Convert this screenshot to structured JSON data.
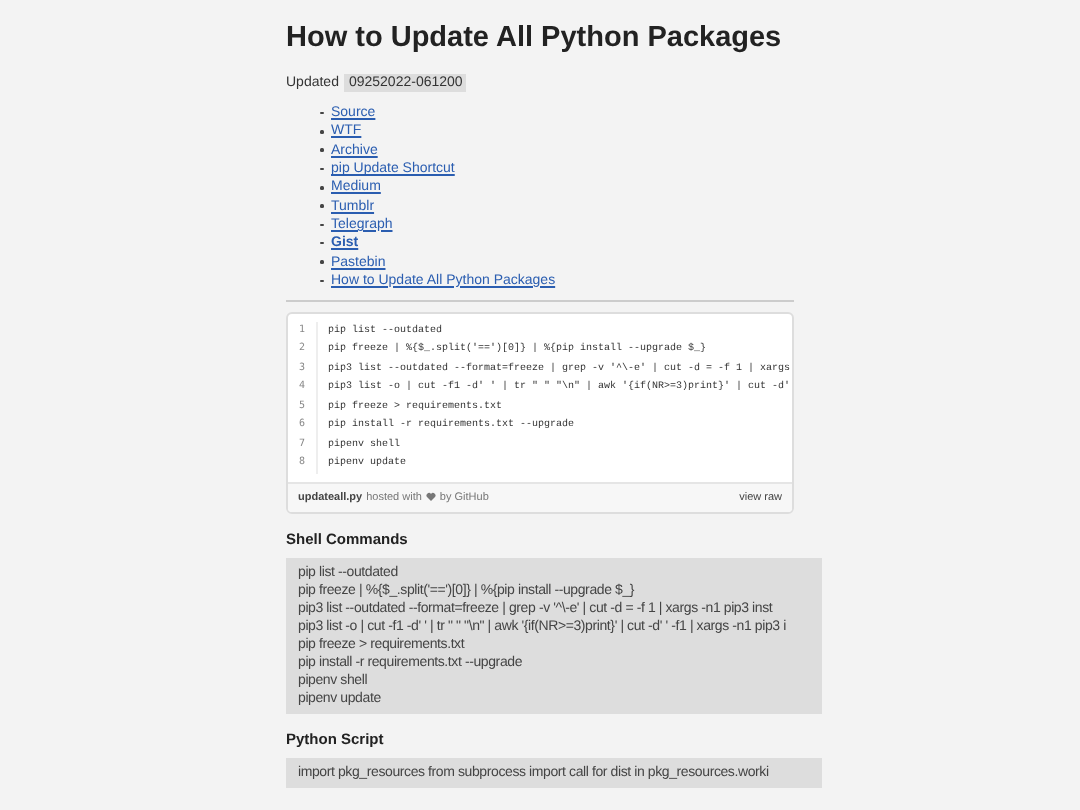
{
  "title": "How to Update All Python Packages",
  "updated": {
    "label": "Updated",
    "stamp": "09252022-061200"
  },
  "links": [
    {
      "label": "Source",
      "selected": false
    },
    {
      "label": "WTF",
      "selected": false
    },
    {
      "label": "Archive",
      "selected": false
    },
    {
      "label": "pip Update Shortcut",
      "selected": false
    },
    {
      "label": "Medium",
      "selected": false
    },
    {
      "label": "Tumblr",
      "selected": false
    },
    {
      "label": "Telegraph",
      "selected": false
    },
    {
      "label": "Gist",
      "selected": true
    },
    {
      "label": "Pastebin",
      "selected": false
    },
    {
      "label": "How to Update All Python Packages",
      "selected": false
    }
  ],
  "gist": {
    "lines": [
      {
        "number": "1",
        "code": "pip list --outdated"
      },
      {
        "number": "2",
        "code": "pip freeze | %{$_.split('==')[0]} | %{pip install --upgrade $_}"
      },
      {
        "number": "3",
        "code": "pip3 list --outdated --format=freeze | grep -v '^\\-e' | cut -d = -f 1 | xargs"
      },
      {
        "number": "4",
        "code": "pip3 list -o | cut -f1 -d' ' | tr \" \" \"\\n\" | awk '{if(NR>=3)print}' | cut -d'"
      },
      {
        "number": "5",
        "code": "pip freeze > requirements.txt"
      },
      {
        "number": "6",
        "code": "pip install -r requirements.txt --upgrade"
      },
      {
        "number": "7",
        "code": "pipenv shell"
      },
      {
        "number": "8",
        "code": "pipenv update"
      }
    ],
    "file": "updateall.py",
    "hosted": "hosted with",
    "by": "by GitHub",
    "raw": "view raw"
  },
  "sections": [
    {
      "heading": "Shell Commands",
      "lines": [
        "pip list --outdated",
        "pip freeze | %{$_.split('==')[0]} | %{pip install --upgrade $_}",
        "pip3 list --outdated --format=freeze | grep -v '^\\-e' | cut -d = -f 1 | xargs -n1 pip3 inst",
        "pip3 list -o | cut -f1 -d' ' | tr \" \" \"\\n\" | awk '{if(NR>=3)print}' | cut -d' ' -f1 | xargs -n1 pip3 i",
        "pip freeze > requirements.txt",
        "pip install -r requirements.txt --upgrade",
        "pipenv shell",
        "pipenv update"
      ]
    },
    {
      "heading": "Python Script",
      "lines": [
        "import pkg_resources from subprocess import call for dist in pkg_resources.worki"
      ]
    }
  ]
}
